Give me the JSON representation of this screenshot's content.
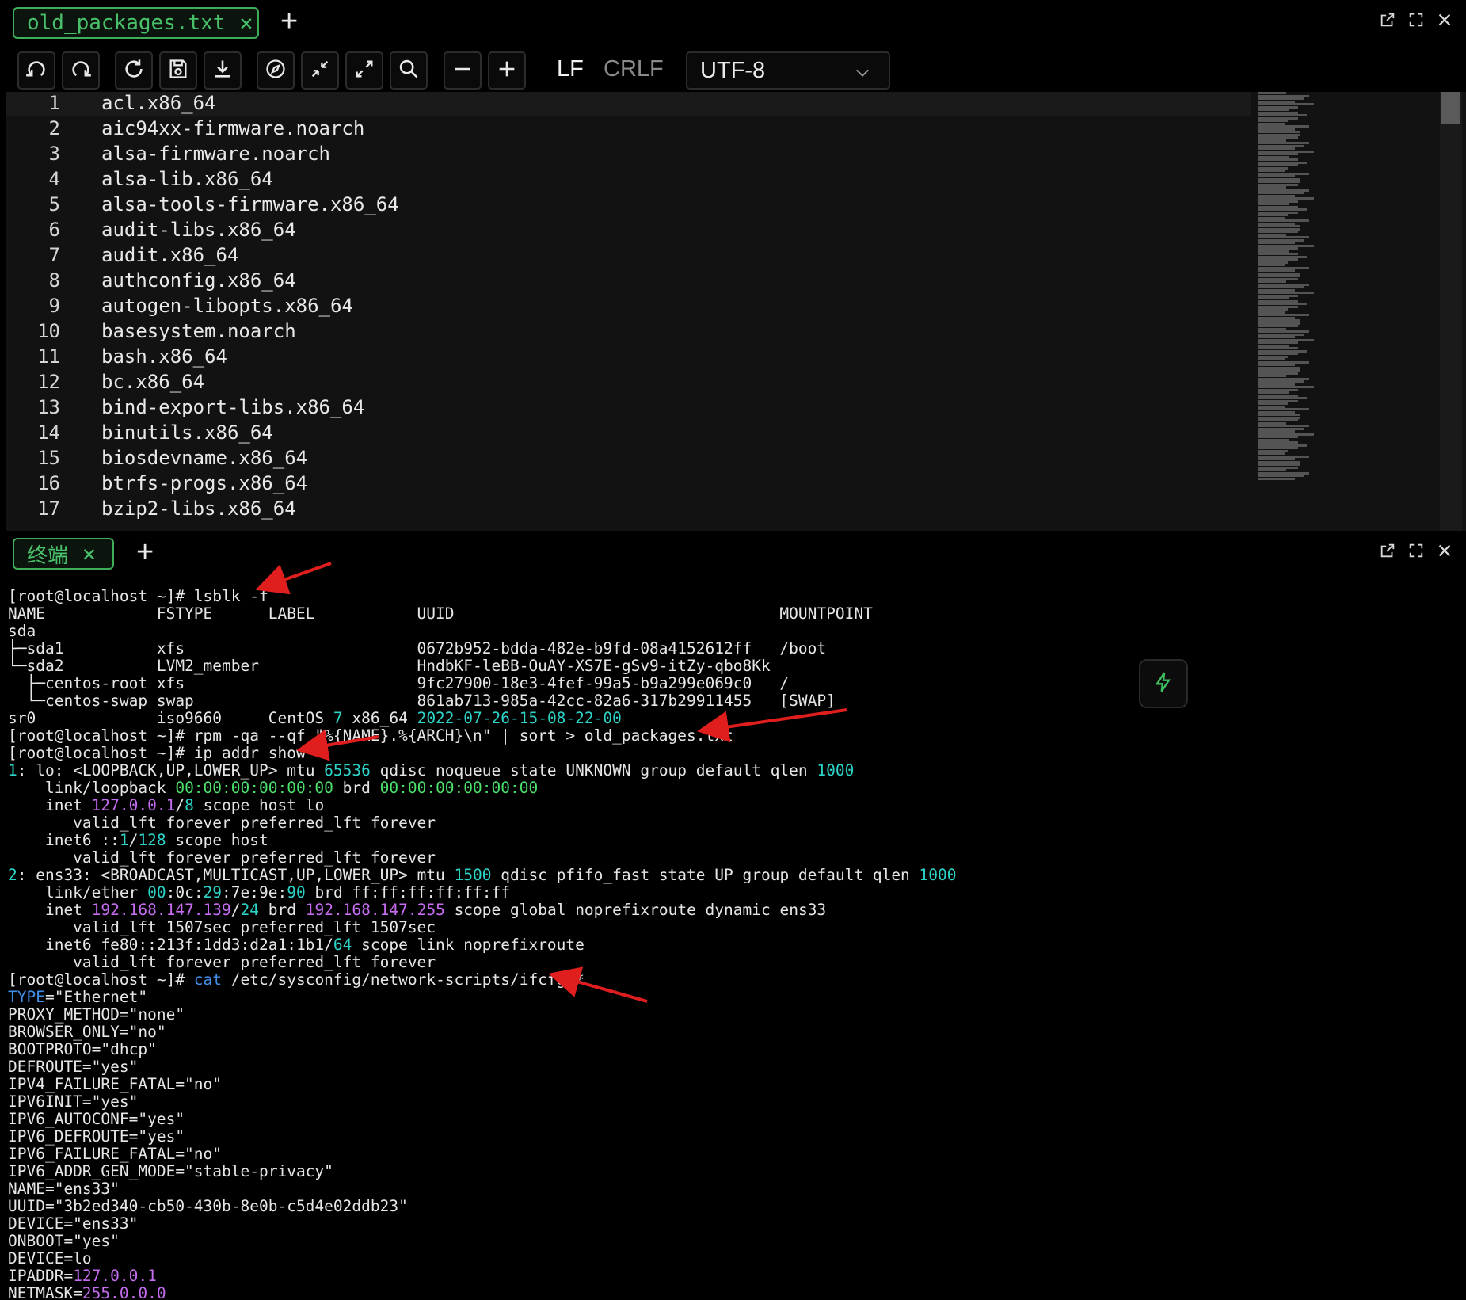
{
  "editor_tab": {
    "title": "old_packages.txt"
  },
  "toolbar": {
    "lf": "LF",
    "crlf": "CRLF",
    "encoding": "UTF-8",
    "buttons": [
      "undo-icon",
      "redo-icon",
      "refresh-icon",
      "save-icon",
      "download-icon",
      "compass-icon",
      "collapse-icon",
      "expand-icon",
      "search-icon",
      "zoom-out-icon",
      "zoom-in-icon"
    ]
  },
  "editor": {
    "lines": [
      {
        "n": "1",
        "t": "acl.x86_64"
      },
      {
        "n": "2",
        "t": "aic94xx-firmware.noarch"
      },
      {
        "n": "3",
        "t": "alsa-firmware.noarch"
      },
      {
        "n": "4",
        "t": "alsa-lib.x86_64"
      },
      {
        "n": "5",
        "t": "alsa-tools-firmware.x86_64"
      },
      {
        "n": "6",
        "t": "audit-libs.x86_64"
      },
      {
        "n": "7",
        "t": "audit.x86_64"
      },
      {
        "n": "8",
        "t": "authconfig.x86_64"
      },
      {
        "n": "9",
        "t": "autogen-libopts.x86_64"
      },
      {
        "n": "10",
        "t": "basesystem.noarch"
      },
      {
        "n": "11",
        "t": "bash.x86_64"
      },
      {
        "n": "12",
        "t": "bc.x86_64"
      },
      {
        "n": "13",
        "t": "bind-export-libs.x86_64"
      },
      {
        "n": "14",
        "t": "binutils.x86_64"
      },
      {
        "n": "15",
        "t": "biosdevname.x86_64"
      },
      {
        "n": "16",
        "t": "btrfs-progs.x86_64"
      },
      {
        "n": "17",
        "t": "bzip2-libs.x86_64"
      }
    ]
  },
  "terminal_tab": {
    "title": "终端"
  },
  "terminal": {
    "lines": [
      [
        {
          "t": "[root@localhost ~]# lsblk -f"
        }
      ],
      [
        {
          "t": "NAME            FSTYPE      LABEL           UUID                                   MOUNTPOINT"
        }
      ],
      [
        {
          "t": "sda"
        }
      ],
      [
        {
          "t": "├─sda1          xfs                         0672b952-bdda-482e-b9fd-08a4152612ff   /boot"
        }
      ],
      [
        {
          "t": "└─sda2          LVM2_member                 HndbKF-leBB-OuAY-XS7E-gSv9-itZy-qbo8Kk"
        }
      ],
      [
        {
          "t": "  ├─centos-root xfs                         9fc27900-18e3-4fef-99a5-b9a299e069c0   /"
        }
      ],
      [
        {
          "t": "  └─centos-swap swap                        861ab713-985a-42cc-82a6-317b29911455   [SWAP]"
        }
      ],
      [
        {
          "t": "sr0             iso9660     CentOS "
        },
        {
          "t": "7",
          "c": "c-cyan"
        },
        {
          "t": " x86_64 "
        },
        {
          "t": "2022-07-26-15-08-22-00",
          "c": "c-cyan"
        }
      ],
      [
        {
          "t": "[root@localhost ~]# rpm -qa --qf \"%{NAME}.%{ARCH}\\n\" | sort > old_packages.txt"
        }
      ],
      [
        {
          "t": "[root@localhost ~]# ip addr show"
        }
      ],
      [
        {
          "t": "1",
          "c": "c-cyan"
        },
        {
          "t": ": lo: <LOOPBACK,UP,LOWER_UP> mtu "
        },
        {
          "t": "65536",
          "c": "c-cyan"
        },
        {
          "t": " qdisc noqueue state UNKNOWN group default qlen "
        },
        {
          "t": "1000",
          "c": "c-cyan"
        }
      ],
      [
        {
          "t": "    link/loopback "
        },
        {
          "t": "00:00:00:00:00:00",
          "c": "c-green"
        },
        {
          "t": " brd "
        },
        {
          "t": "00:00:00:00:00:00",
          "c": "c-green"
        }
      ],
      [
        {
          "t": "    inet "
        },
        {
          "t": "127.0.0.1",
          "c": "c-mag"
        },
        {
          "t": "/"
        },
        {
          "t": "8",
          "c": "c-cyan"
        },
        {
          "t": " scope host lo"
        }
      ],
      [
        {
          "t": "       valid_lft forever preferred_lft forever"
        }
      ],
      [
        {
          "t": "    inet6 ::"
        },
        {
          "t": "1",
          "c": "c-cyan"
        },
        {
          "t": "/"
        },
        {
          "t": "128",
          "c": "c-cyan"
        },
        {
          "t": " scope host"
        }
      ],
      [
        {
          "t": "       valid_lft forever preferred_lft forever"
        }
      ],
      [
        {
          "t": "2",
          "c": "c-cyan"
        },
        {
          "t": ": ens33: <BROADCAST,MULTICAST,UP,LOWER_UP> mtu "
        },
        {
          "t": "1500",
          "c": "c-cyan"
        },
        {
          "t": " qdisc pfifo_fast state UP group default qlen "
        },
        {
          "t": "1000",
          "c": "c-cyan"
        }
      ],
      [
        {
          "t": "    link/ether "
        },
        {
          "t": "00",
          "c": "c-cyan"
        },
        {
          "t": ":0c:"
        },
        {
          "t": "29",
          "c": "c-cyan"
        },
        {
          "t": ":7e:9e:"
        },
        {
          "t": "90",
          "c": "c-cyan"
        },
        {
          "t": " brd ff:ff:ff:ff:ff:ff"
        }
      ],
      [
        {
          "t": "    inet "
        },
        {
          "t": "192.168.147.139",
          "c": "c-mag"
        },
        {
          "t": "/"
        },
        {
          "t": "24",
          "c": "c-cyan"
        },
        {
          "t": " brd "
        },
        {
          "t": "192.168.147.255",
          "c": "c-mag"
        },
        {
          "t": " scope global noprefixroute dynamic ens33"
        }
      ],
      [
        {
          "t": "       valid_lft 1507sec preferred_lft 1507sec"
        }
      ],
      [
        {
          "t": "    inet6 fe80::213f:1dd3:d2a1:1b1/"
        },
        {
          "t": "64",
          "c": "c-cyan"
        },
        {
          "t": " scope link noprefixroute"
        }
      ],
      [
        {
          "t": "       valid_lft forever preferred_lft forever"
        }
      ],
      [
        {
          "t": "[root@localhost ~]# "
        },
        {
          "t": "cat",
          "c": "c-blue"
        },
        {
          "t": " /etc/sysconfig/network-scripts/ifcfg-*"
        }
      ],
      [
        {
          "t": "TYPE",
          "c": "c-blue"
        },
        {
          "t": "=\"Ethernet\""
        }
      ],
      [
        {
          "t": "PROXY_METHOD=\"none\""
        }
      ],
      [
        {
          "t": "BROWSER_ONLY=\"no\""
        }
      ],
      [
        {
          "t": "BOOTPROTO=\"dhcp\""
        }
      ],
      [
        {
          "t": "DEFROUTE=\"yes\""
        }
      ],
      [
        {
          "t": "IPV4_FAILURE_FATAL=\"no\""
        }
      ],
      [
        {
          "t": "IPV6INIT=\"yes\""
        }
      ],
      [
        {
          "t": "IPV6_AUTOCONF=\"yes\""
        }
      ],
      [
        {
          "t": "IPV6_DEFROUTE=\"yes\""
        }
      ],
      [
        {
          "t": "IPV6_FAILURE_FATAL=\"no\""
        }
      ],
      [
        {
          "t": "IPV6_ADDR_GEN_MODE=\"stable-privacy\""
        }
      ],
      [
        {
          "t": "NAME=\"ens33\""
        }
      ],
      [
        {
          "t": "UUID=\"3b2ed340-cb50-430b-8e0b-c5d4e02ddb23\""
        }
      ],
      [
        {
          "t": "DEVICE=\"ens33\""
        }
      ],
      [
        {
          "t": "ONBOOT=\"yes\""
        }
      ],
      [
        {
          "t": "DEVICE=lo"
        }
      ],
      [
        {
          "t": "IPADDR="
        },
        {
          "t": "127.0.0.1",
          "c": "c-mag"
        }
      ],
      [
        {
          "t": "NETMASK="
        },
        {
          "t": "255.0.0.0",
          "c": "c-mag"
        }
      ]
    ]
  },
  "colors": {
    "accent_green": "#49c16a",
    "annotation_red": "#e01e1e",
    "terminal_cyan": "#2cd3c7",
    "terminal_magenta": "#c56cf0"
  }
}
